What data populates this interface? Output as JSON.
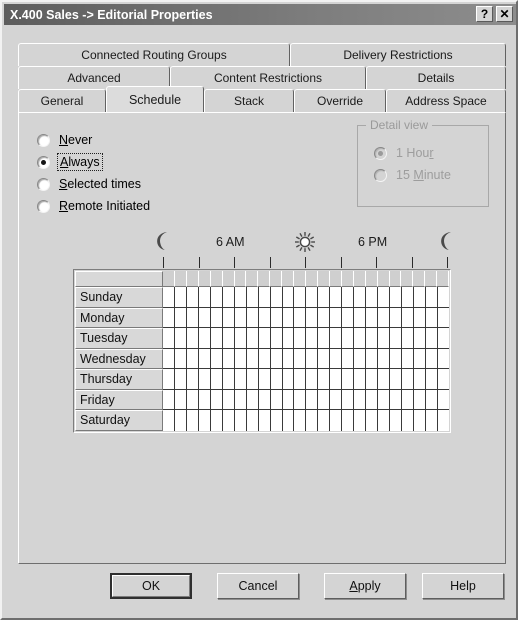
{
  "window": {
    "title": "X.400 Sales -> Editorial Properties",
    "help_button": "?",
    "close_button": "✕"
  },
  "tabs": {
    "row1": [
      {
        "label": "Connected Routing Groups",
        "active": false
      },
      {
        "label": "Delivery Restrictions",
        "active": false
      }
    ],
    "row2": [
      {
        "label": "Advanced",
        "active": false
      },
      {
        "label": "Content Restrictions",
        "active": false
      },
      {
        "label": "Details",
        "active": false
      }
    ],
    "row3": [
      {
        "label": "General",
        "active": false
      },
      {
        "label": "Schedule",
        "active": true
      },
      {
        "label": "Stack",
        "active": false
      },
      {
        "label": "Override",
        "active": false
      },
      {
        "label": "Address Space",
        "active": false
      }
    ]
  },
  "schedule_options": {
    "items": [
      {
        "label": "Never",
        "mnemonic": "N",
        "checked": false,
        "focused": false
      },
      {
        "label": "Always",
        "mnemonic": "A",
        "checked": true,
        "focused": true
      },
      {
        "label": "Selected times",
        "mnemonic": "S",
        "checked": false,
        "focused": false
      },
      {
        "label": "Remote Initiated",
        "mnemonic": "R",
        "checked": false,
        "focused": false
      }
    ]
  },
  "detail_view": {
    "title": "Detail view",
    "enabled": false,
    "items": [
      {
        "label": "1 Hour",
        "mnemonic": "r",
        "checked": true
      },
      {
        "label": "15 Minute",
        "mnemonic": "M",
        "checked": false
      }
    ]
  },
  "schedule_grid": {
    "time_labels": [
      {
        "text": "6 AM",
        "hour": 6
      },
      {
        "text": "6 PM",
        "hour": 18
      }
    ],
    "icons": [
      {
        "name": "moon-icon",
        "hour": 0
      },
      {
        "name": "sun-icon",
        "hour": 12
      },
      {
        "name": "moon-icon",
        "hour": 24
      }
    ],
    "tick_hours": [
      0,
      3,
      6,
      9,
      12,
      15,
      18,
      21,
      24
    ],
    "hours_count": 24,
    "days": [
      "Sunday",
      "Monday",
      "Tuesday",
      "Wednesday",
      "Thursday",
      "Friday",
      "Saturday"
    ],
    "selected_cells": []
  },
  "buttons": [
    {
      "label": "OK",
      "default": true,
      "mnemonic": ""
    },
    {
      "label": "Cancel",
      "default": false,
      "mnemonic": ""
    },
    {
      "label": "Apply",
      "default": false,
      "mnemonic": "A"
    },
    {
      "label": "Help",
      "default": false,
      "mnemonic": ""
    }
  ],
  "colors": {
    "face": "#d4d4d4",
    "titlebar": "#6e6e6e",
    "grid_line": "#3a3a3a",
    "disabled_text": "#9a9a9a"
  }
}
